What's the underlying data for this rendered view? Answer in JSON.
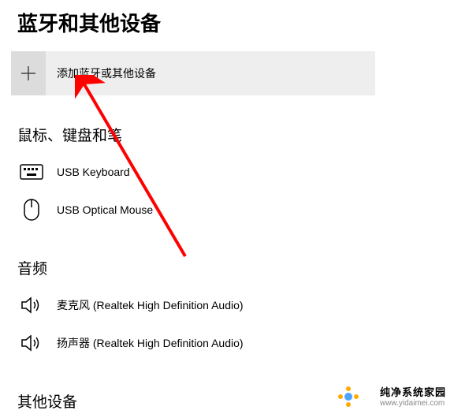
{
  "page_title": "蓝牙和其他设备",
  "add_device_label": "添加蓝牙或其他设备",
  "sections": {
    "input_devices": {
      "heading": "鼠标、键盘和笔",
      "items": [
        {
          "name": "USB Keyboard",
          "icon": "keyboard-icon"
        },
        {
          "name": "USB Optical Mouse",
          "icon": "mouse-icon"
        }
      ]
    },
    "audio": {
      "heading": "音频",
      "items": [
        {
          "name": "麦克风 (Realtek High Definition Audio)",
          "icon": "speaker-icon"
        },
        {
          "name": "扬声器 (Realtek High Definition Audio)",
          "icon": "speaker-icon"
        }
      ]
    },
    "other": {
      "heading": "其他设备"
    }
  },
  "watermark": {
    "title": "纯净系统家园",
    "url": "www.yidaimei.com"
  },
  "annotation_arrow_color": "#ff0000"
}
